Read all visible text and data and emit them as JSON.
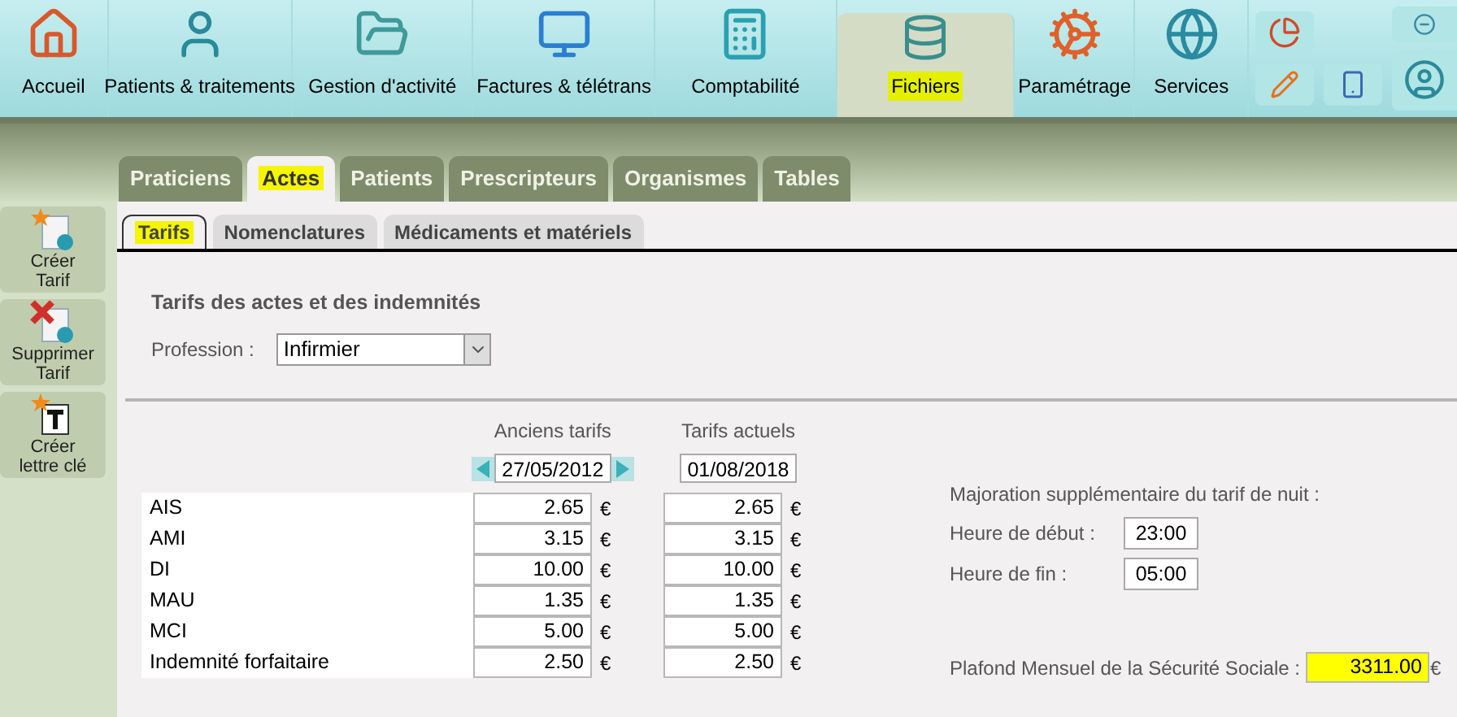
{
  "toolbar": {
    "items": [
      {
        "label": "Accueil",
        "selected": false
      },
      {
        "label": "Patients & traitements",
        "selected": false
      },
      {
        "label": "Gestion d'activité",
        "selected": false
      },
      {
        "label": "Factures & télétrans",
        "selected": false
      },
      {
        "label": "Comptabilité",
        "selected": false
      },
      {
        "label": "Fichiers",
        "selected": true
      },
      {
        "label": "Paramétrage",
        "selected": false
      },
      {
        "label": "Services",
        "selected": false
      }
    ]
  },
  "tabs": [
    {
      "label": "Praticiens",
      "selected": false
    },
    {
      "label": "Actes",
      "selected": true
    },
    {
      "label": "Patients",
      "selected": false
    },
    {
      "label": "Prescripteurs",
      "selected": false
    },
    {
      "label": "Organismes",
      "selected": false
    },
    {
      "label": "Tables",
      "selected": false
    }
  ],
  "sidebar": {
    "buttons": [
      {
        "kind": "create",
        "lines": [
          "Créer",
          "Tarif"
        ]
      },
      {
        "kind": "delete",
        "lines": [
          "Supprimer",
          "Tarif"
        ]
      },
      {
        "kind": "letter",
        "lines": [
          "Créer",
          "lettre clé"
        ]
      }
    ]
  },
  "subtabs": [
    {
      "label": "Tarifs",
      "selected": true
    },
    {
      "label": "Nomenclatures",
      "selected": false
    },
    {
      "label": "Médicaments et matériels",
      "selected": false
    }
  ],
  "section_title": "Tarifs des actes et des indemnités",
  "profession": {
    "label": "Profession :",
    "value": "Infirmier"
  },
  "columns": [
    {
      "header": "Anciens tarifs",
      "date": "27/05/2012",
      "arrows": true
    },
    {
      "header": "Tarifs actuels",
      "date": "01/08/2018",
      "arrows": false
    }
  ],
  "rows": [
    {
      "name": "AIS",
      "old": "2.65",
      "old_unit": "€",
      "new": "2.65",
      "new_unit": "€"
    },
    {
      "name": "AMI",
      "old": "3.15",
      "old_unit": "€",
      "new": "3.15",
      "new_unit": "€"
    },
    {
      "name": "DI",
      "old": "10.00",
      "old_unit": "€",
      "new": "10.00",
      "new_unit": "€"
    },
    {
      "name": "MAU",
      "old": "1.35",
      "old_unit": "€",
      "new": "1.35",
      "new_unit": "€"
    },
    {
      "name": "MCI",
      "old": "5.00",
      "old_unit": "€",
      "new": "5.00",
      "new_unit": "€"
    },
    {
      "name": "Indemnité forfaitaire",
      "old": "2.50",
      "old_unit": "€",
      "new": "2.50",
      "new_unit": "€"
    }
  ],
  "night": {
    "title": "Majoration supplémentaire du tarif de nuit :",
    "start": {
      "label": "Heure de début :",
      "value": "23:00"
    },
    "end": {
      "label": "Heure de fin :",
      "value": "05:00"
    }
  },
  "plafond": {
    "label": "Plafond Mensuel de la Sécurité Sociale :",
    "value": "3311.00",
    "unit": "€",
    "highlighted": true
  }
}
